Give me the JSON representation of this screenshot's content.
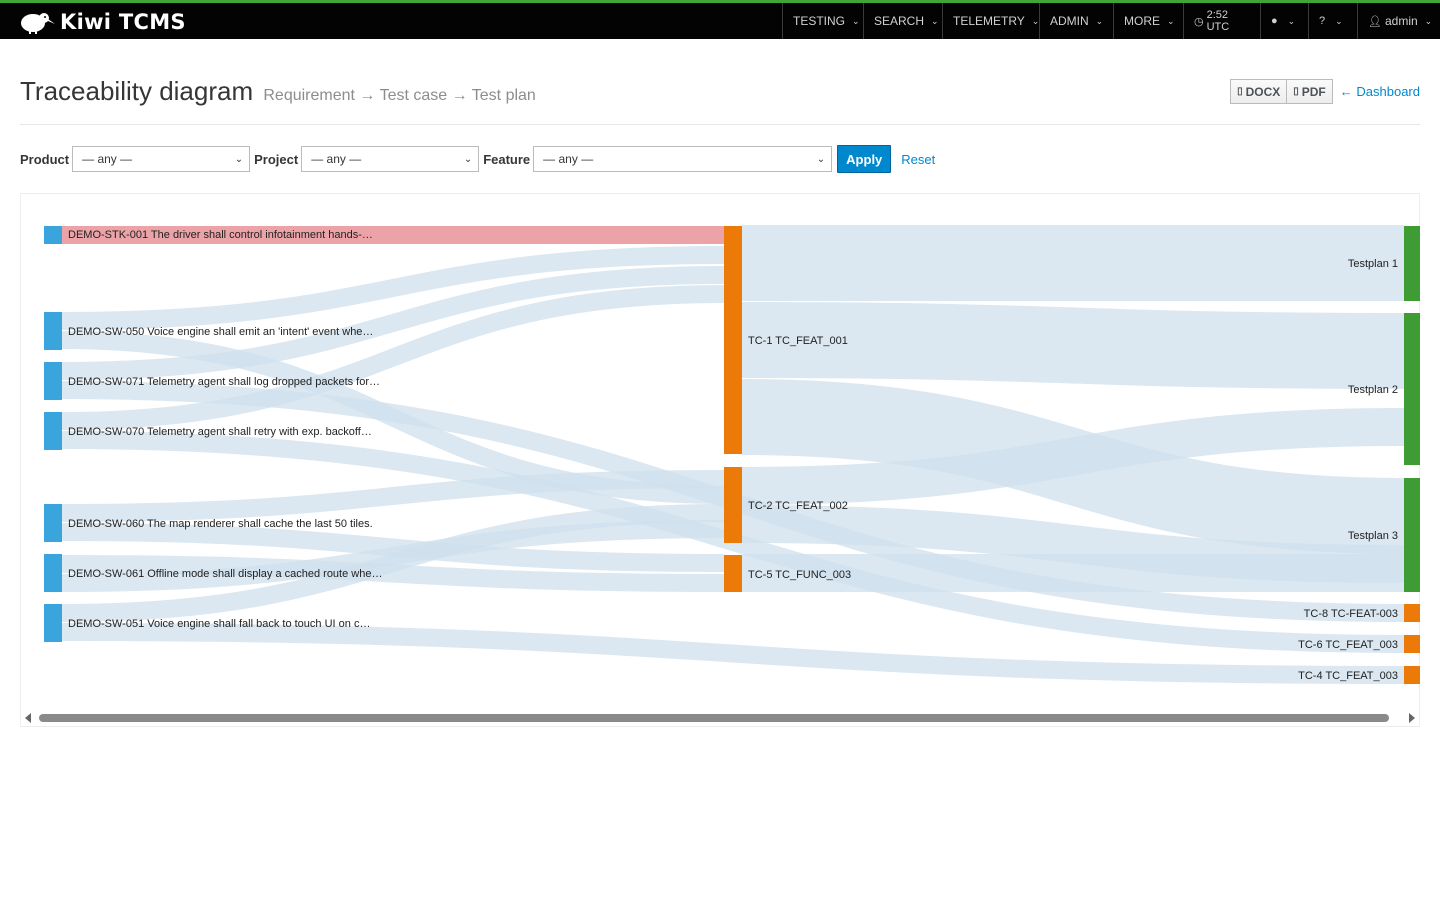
{
  "app": {
    "name": "Kiwi TCMS",
    "logo_small": "OSS"
  },
  "nav": {
    "testing": "TESTING",
    "search": "SEARCH",
    "telemetry": "TELEMETRY",
    "admin": "ADMIN",
    "more": "MORE",
    "time": "2:52 UTC",
    "user": "admin"
  },
  "page": {
    "title": "Traceability diagram",
    "subtitle_req": "Requirement",
    "subtitle_tc": "Test case",
    "subtitle_tp": "Test plan",
    "arrow": "→"
  },
  "toolbar": {
    "docx": "DOCX",
    "pdf": "PDF",
    "dashboard": "Dashboard"
  },
  "filters": {
    "product_label": "Product",
    "product_value": "— any —",
    "project_label": "Project",
    "project_value": "— any —",
    "feature_label": "Feature",
    "feature_value": "— any —",
    "apply": "Apply",
    "reset": "Reset"
  },
  "colors": {
    "requirement": "#39a5dc",
    "requirement_highlight": "#eba3a8",
    "testcase": "#ec7a08",
    "testplan": "#3f9c35",
    "link": "#cfe0ec",
    "topbar_accent": "#3fa535"
  },
  "diagram": {
    "requirements": [
      {
        "id": "req-stk-001",
        "label": "DEMO-STK-001 The driver shall control infotainment hands-…",
        "highlighted": true
      },
      {
        "id": "req-sw-050",
        "label": "DEMO-SW-050 Voice engine shall emit an 'intent' event whe…"
      },
      {
        "id": "req-sw-071",
        "label": "DEMO-SW-071 Telemetry agent shall log dropped packets for…"
      },
      {
        "id": "req-sw-070",
        "label": "DEMO-SW-070 Telemetry agent shall retry with exp. backoff…"
      },
      {
        "id": "req-sw-060",
        "label": "DEMO-SW-060 The map renderer shall cache the last 50 tiles."
      },
      {
        "id": "req-sw-061",
        "label": "DEMO-SW-061 Offline mode shall display a cached route whe…"
      },
      {
        "id": "req-sw-051",
        "label": "DEMO-SW-051 Voice engine shall fall back to touch UI on c…"
      }
    ],
    "testcases": [
      {
        "id": "tc-1",
        "label": "TC-1 TC_FEAT_001"
      },
      {
        "id": "tc-2",
        "label": "TC-2 TC_FEAT_002"
      },
      {
        "id": "tc-5",
        "label": "TC-5 TC_FUNC_003"
      }
    ],
    "testplans": [
      {
        "id": "tp-1",
        "label": "Testplan 1"
      },
      {
        "id": "tp-2",
        "label": "Testplan 2"
      },
      {
        "id": "tp-3",
        "label": "Testplan 3"
      }
    ],
    "orphans": [
      {
        "id": "tc-8",
        "label": "TC-8 TC-FEAT-003"
      },
      {
        "id": "tc-6",
        "label": "TC-6 TC_FEAT_003"
      },
      {
        "id": "tc-4",
        "label": "TC-4 TC_FEAT_003"
      }
    ]
  }
}
